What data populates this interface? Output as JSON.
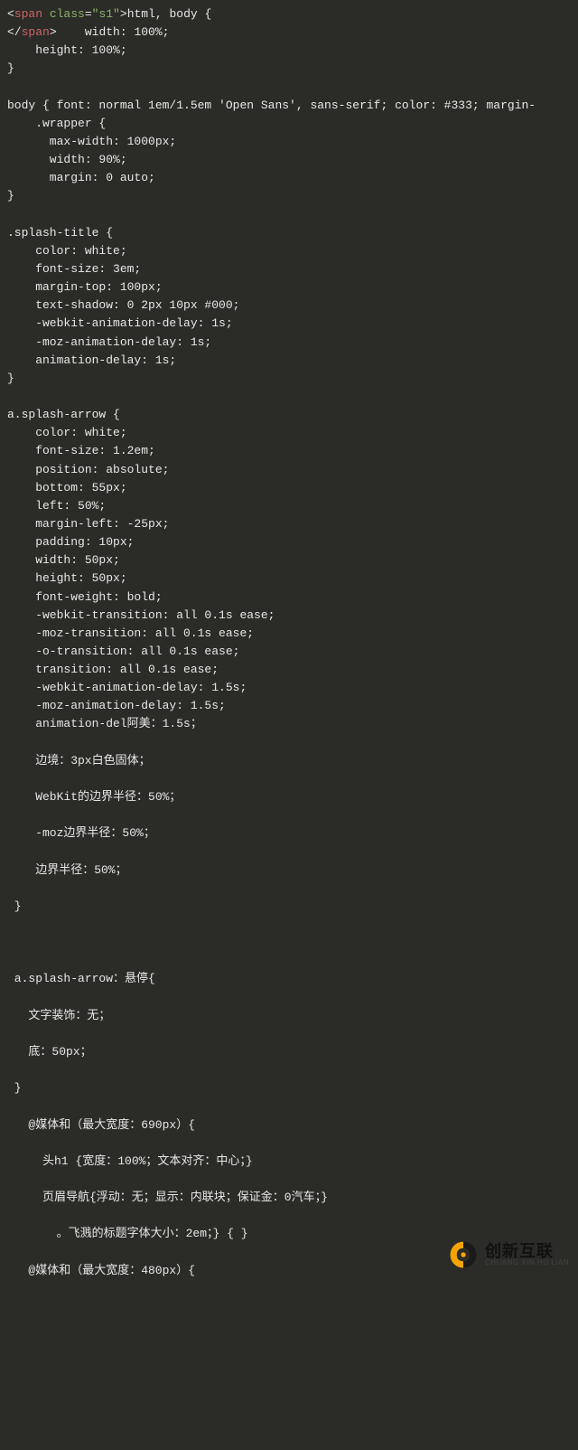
{
  "code": {
    "l1_a": "<",
    "l1_b": "span",
    "l1_c": " class",
    "l1_d": "=",
    "l1_e": "\"s1\"",
    "l1_f": ">",
    "l1_g": "html, body {",
    "l2_a": "</",
    "l2_b": "span",
    "l2_c": ">",
    "l2_d": "    width: 100%;",
    "l3": "    height: 100%;",
    "l4": "}",
    "l5": "",
    "l6": "body { font: normal 1em/1.5em 'Open Sans', sans-serif; color: #333; margin-",
    "l7": "    .wrapper {",
    "l8": "      max-width: 1000px;",
    "l9": "      width: 90%;",
    "l10": "      margin: 0 auto;",
    "l11": "}",
    "l12": "",
    "l13": ".splash-title {",
    "l14": "    color: white;",
    "l15": "    font-size: 3em;",
    "l16": "    margin-top: 100px;",
    "l17": "    text-shadow: 0 2px 10px #000;",
    "l18": "    -webkit-animation-delay: 1s;",
    "l19": "    -moz-animation-delay: 1s;",
    "l20": "    animation-delay: 1s;",
    "l21": "}",
    "l22": "",
    "l23": "a.splash-arrow {",
    "l24": "    color: white;",
    "l25": "    font-size: 1.2em;",
    "l26": "    position: absolute;",
    "l27": "    bottom: 55px;",
    "l28": "    left: 50%;",
    "l29": "    margin-left: -25px;",
    "l30": "    padding: 10px;",
    "l31": "    width: 50px;",
    "l32": "    height: 50px;",
    "l33": "    font-weight: bold;",
    "l34": "    -webkit-transition: all 0.1s ease;",
    "l35": "    -moz-transition: all 0.1s ease;",
    "l36": "    -o-transition: all 0.1s ease;",
    "l37": "    transition: all 0.1s ease;",
    "l38": "    -webkit-animation-delay: 1.5s;",
    "l39": "    -moz-animation-delay: 1.5s;",
    "l40": "    animation-del阿美：1.5s；",
    "l41": "",
    "l42": "    边境：3px白色固体；",
    "l43": "",
    "l44": "    WebKit的边界半径：50%；",
    "l45": "",
    "l46": "    -moz边界半径：50%；",
    "l47": "",
    "l48": "    边界半径：50%；",
    "l49": "",
    "l50": " }",
    "l51": "",
    "l52": "",
    "l53": "",
    "l54": " a.splash-arrow：悬停{",
    "l55": "",
    "l56": "   文字装饰：无；",
    "l57": "",
    "l58": "   底：50px；",
    "l59": "",
    "l60": " }",
    "l61": "",
    "l62": "   @媒体和（最大宽度：690px）{",
    "l63": "",
    "l64": "     头h1 {宽度：100%；文本对齐：中心；}",
    "l65": "",
    "l66": "     页眉导航{浮动：无；显示：内联块；保证金：0汽车；}",
    "l67": "",
    "l68": "       。飞溅的标题字体大小：2em；} { }",
    "l69": "",
    "l70": "   @媒体和（最大宽度：480px）{"
  },
  "watermark": {
    "main": "创新互联",
    "sub": "CHUANG XIN HU LIAN"
  }
}
